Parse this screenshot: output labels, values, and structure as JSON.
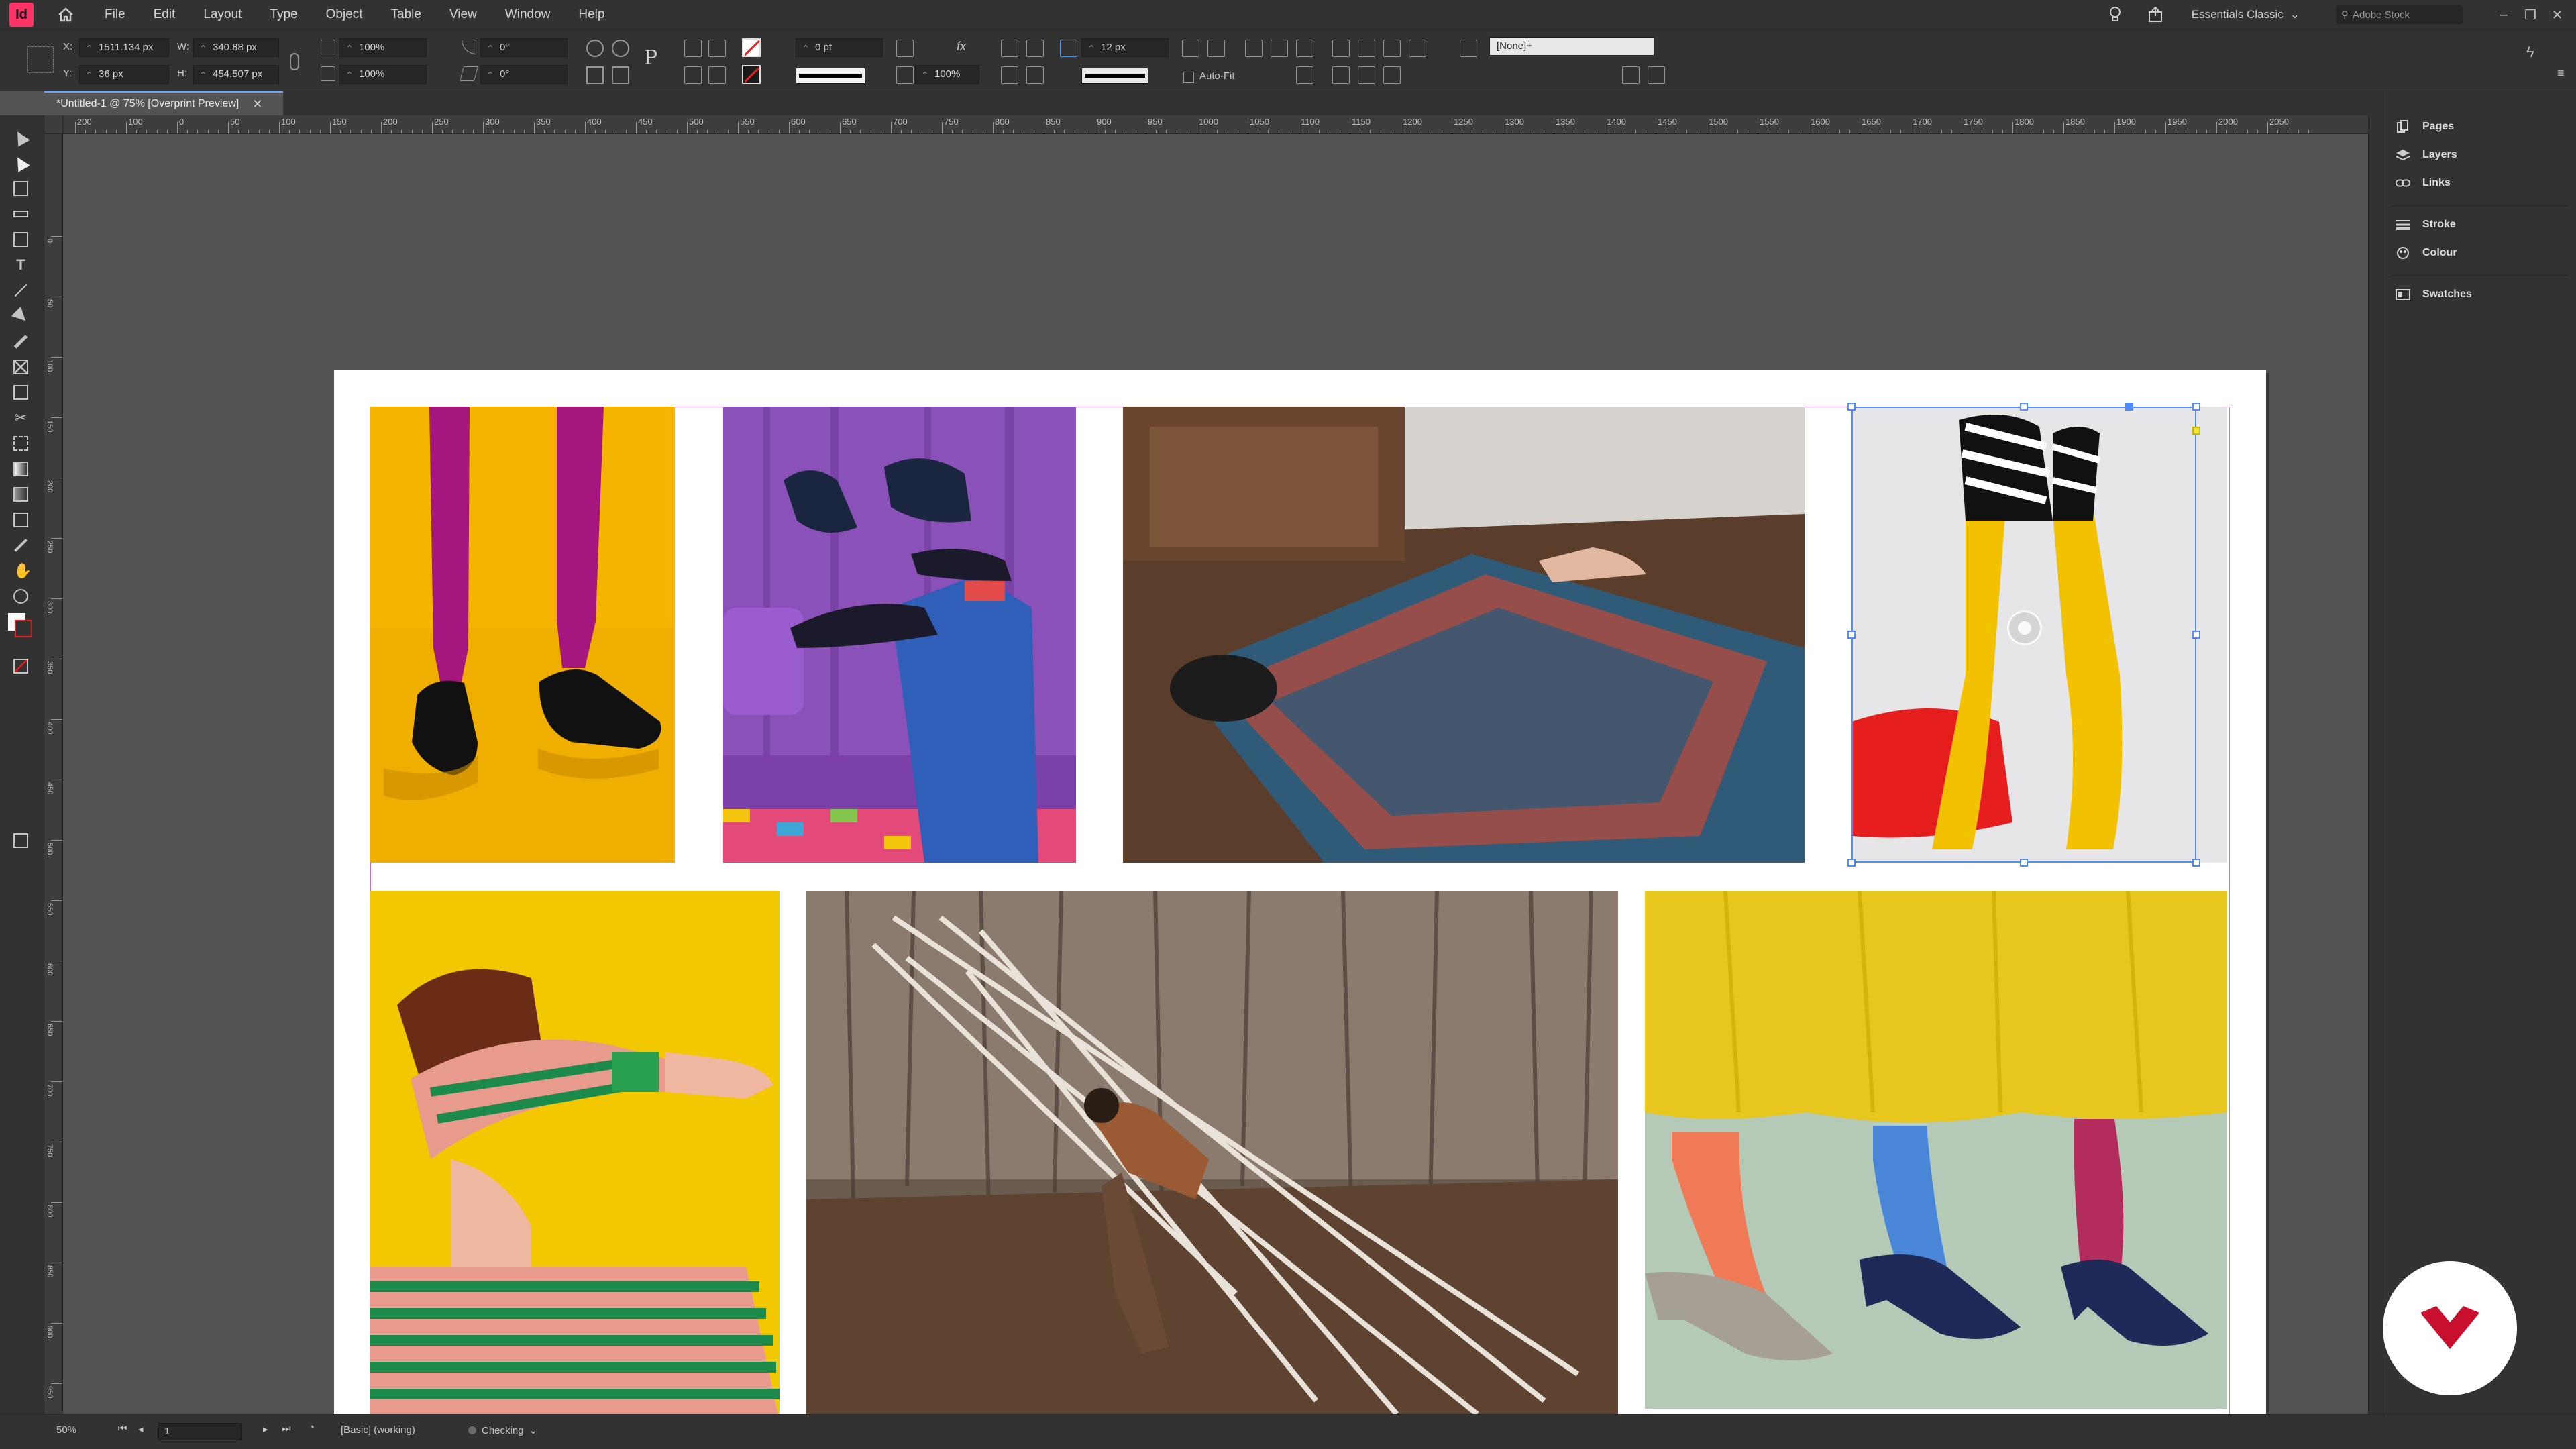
{
  "app": {
    "logo_text": "Id"
  },
  "menu": [
    "File",
    "Edit",
    "Layout",
    "Type",
    "Object",
    "Table",
    "View",
    "Window",
    "Help"
  ],
  "menubar_right": {
    "workspace": "Essentials Classic",
    "stock_placeholder": "Adobe Stock"
  },
  "control_panel": {
    "x_label": "X:",
    "x_value": "1511.134 px",
    "y_label": "Y:",
    "y_value": "36 px",
    "w_label": "W:",
    "w_value": "340.88 px",
    "h_label": "H:",
    "h_value": "454.507 px",
    "scale_x": "100%",
    "scale_y": "100%",
    "rotate": "0°",
    "shear": "0°",
    "stroke_weight": "0 pt",
    "opacity": "100%",
    "fitting_gap": "12 px",
    "autofit_label": "Auto-Fit",
    "object_style": "[None]+"
  },
  "document_tab": {
    "title": "*Untitled-1 @ 75% [Overprint Preview]"
  },
  "rulers": {
    "horizontal_labels": [
      "200",
      "100",
      "0",
      "50",
      "100",
      "150",
      "200",
      "250",
      "300",
      "350",
      "400",
      "450",
      "500",
      "550",
      "600",
      "650",
      "700",
      "750",
      "800",
      "850",
      "900",
      "950",
      "1000",
      "1050",
      "1100",
      "1150",
      "1200",
      "1250",
      "1300",
      "1350",
      "1400",
      "1450",
      "1500",
      "1550",
      "1600",
      "1650",
      "1700",
      "1750",
      "1800",
      "1850",
      "1900",
      "1950",
      "2000",
      "2050"
    ],
    "vertical_labels": [
      "0",
      "50",
      "100",
      "150",
      "200",
      "250",
      "300",
      "350",
      "400",
      "450",
      "500",
      "550",
      "600",
      "650",
      "700",
      "750",
      "800",
      "850",
      "900",
      "950"
    ]
  },
  "panels": [
    "Pages",
    "Layers",
    "Links",
    "Stroke",
    "Colour",
    "Swatches"
  ],
  "status_bar": {
    "zoom": "50%",
    "page": "1",
    "profile": "[Basic] (working)",
    "preflight": "Checking"
  },
  "images": [
    {
      "name": "magenta-tights-loafers",
      "bg": "#f5b400"
    },
    {
      "name": "crows-on-shoes",
      "bg": "#7b3fa8"
    },
    {
      "name": "person-rolled-in-rug",
      "bg": "#6a4e3c"
    },
    {
      "name": "yellow-tights-legs-up",
      "bg": "#e6e6e8"
    },
    {
      "name": "striped-shirt-person",
      "bg": "#f4c800"
    },
    {
      "name": "person-carrying-branches",
      "bg": "#5b4a3d"
    },
    {
      "name": "colorful-socks-heels",
      "bg": "#c9d6c8"
    }
  ],
  "colors": {
    "selection": "#4f8cff",
    "app_accent": "#ff3366",
    "brand": "#c8102e"
  }
}
